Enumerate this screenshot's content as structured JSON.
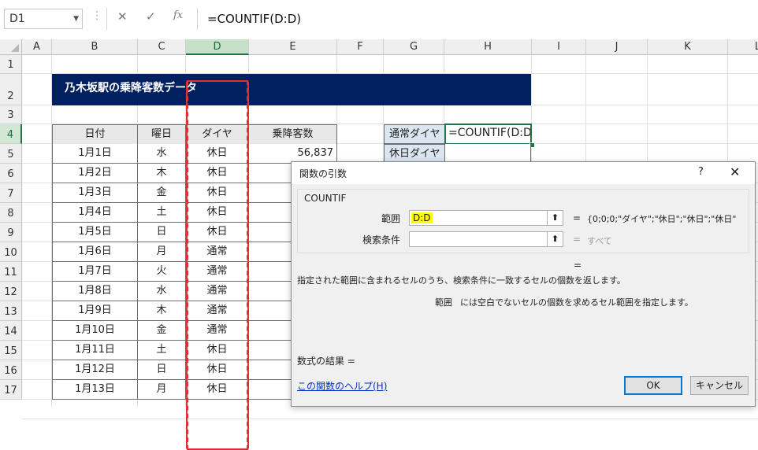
{
  "formula_bar": {
    "name_box": "D1",
    "cancel_icon": "✕",
    "enter_icon": "✓",
    "fx_label": "fx",
    "formula": "=COUNTIF(D:D)"
  },
  "columns": [
    "A",
    "B",
    "C",
    "D",
    "E",
    "F",
    "G",
    "H",
    "I",
    "J",
    "K",
    "L"
  ],
  "rows": [
    "1",
    "2",
    "3",
    "4",
    "5",
    "6",
    "7",
    "8",
    "9",
    "10",
    "11",
    "12",
    "13",
    "14",
    "15",
    "16",
    "17"
  ],
  "title": "乃木坂駅の乗降客数データ",
  "table": {
    "headers": [
      "日付",
      "曜日",
      "ダイヤ",
      "乗降客数"
    ],
    "rows": [
      {
        "date": "1月1日",
        "dow": "水",
        "dia": "休日",
        "count": "56,837"
      },
      {
        "date": "1月2日",
        "dow": "木",
        "dia": "休日",
        "count": ""
      },
      {
        "date": "1月3日",
        "dow": "金",
        "dia": "休日",
        "count": ""
      },
      {
        "date": "1月4日",
        "dow": "土",
        "dia": "休日",
        "count": ""
      },
      {
        "date": "1月5日",
        "dow": "日",
        "dia": "休日",
        "count": ""
      },
      {
        "date": "1月6日",
        "dow": "月",
        "dia": "通常",
        "count": ""
      },
      {
        "date": "1月7日",
        "dow": "火",
        "dia": "通常",
        "count": ""
      },
      {
        "date": "1月8日",
        "dow": "水",
        "dia": "通常",
        "count": ""
      },
      {
        "date": "1月9日",
        "dow": "木",
        "dia": "通常",
        "count": ""
      },
      {
        "date": "1月10日",
        "dow": "金",
        "dia": "通常",
        "count": ""
      },
      {
        "date": "1月11日",
        "dow": "土",
        "dia": "休日",
        "count": ""
      },
      {
        "date": "1月12日",
        "dow": "日",
        "dia": "休日",
        "count": ""
      },
      {
        "date": "1月13日",
        "dow": "月",
        "dia": "休日",
        "count": ""
      }
    ]
  },
  "side": {
    "g4": "通常ダイヤ",
    "h4": "=COUNTIF(D:D)",
    "g5": "休日ダイヤ"
  },
  "dialog": {
    "title": "関数の引数",
    "help": "?",
    "close": "✕",
    "function_name": "COUNTIF",
    "arg1_label": "範囲",
    "arg1_value": "D:D",
    "arg1_eq": "=",
    "arg1_result": "{0;0;0;\"ダイヤ\";\"休日\";\"休日\";\"休日\"",
    "arg2_label": "検索条件",
    "arg2_value": "",
    "arg2_eq": "=",
    "arg2_result": "すべて",
    "result_eq": "=",
    "description": "指定された範囲に含まれるセルのうち、検索条件に一致するセルの個数を返します。",
    "argdesc_name": "範囲",
    "argdesc": "には空白でないセルの個数を求めるセル範囲を指定します。",
    "formula_result": "数式の結果 =",
    "help_link": "この関数のヘルプ(H)",
    "ok": "OK",
    "cancel": "キャンセル",
    "ref_icon": "⬆"
  },
  "colors": {
    "title_bg": "#002060",
    "selection": "#217346",
    "annotation_red": "#e03030",
    "label_bg": "#dce6f1",
    "highlight": "#ffff00"
  }
}
